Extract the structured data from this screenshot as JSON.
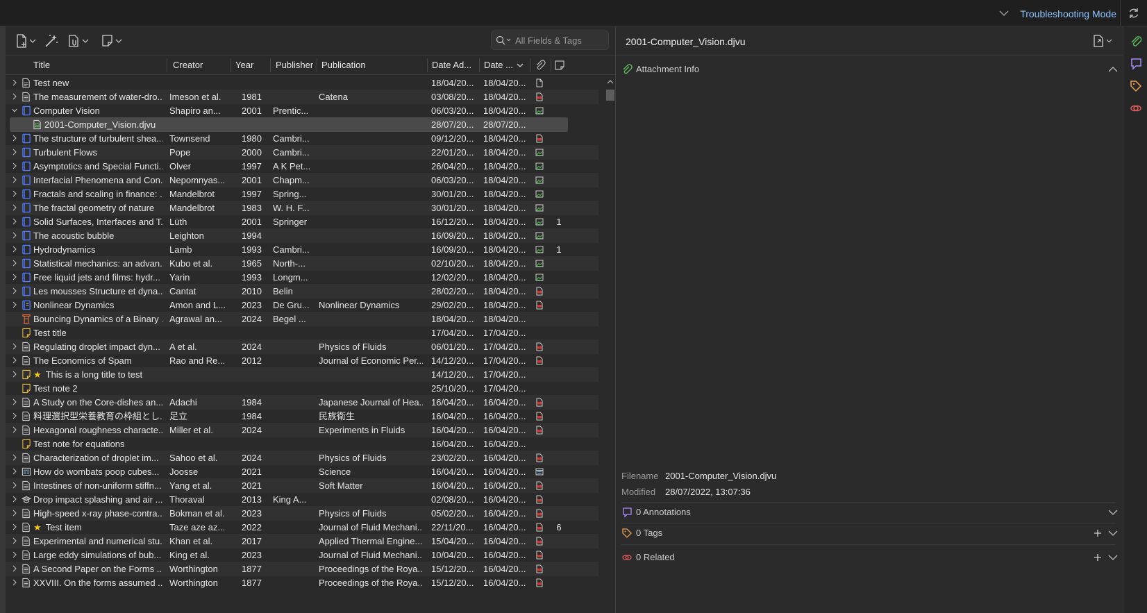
{
  "topbar": {
    "troubleshooting_label": "Troubleshooting Mode"
  },
  "search": {
    "placeholder": "All Fields & Tags"
  },
  "columns": {
    "title": "Title",
    "creator": "Creator",
    "year": "Year",
    "publisher": "Publisher",
    "publication": "Publication",
    "date_added": "Date Ad...",
    "date_modified": "Date ..."
  },
  "rows": [
    {
      "title": "Test new",
      "creator": "",
      "year": "",
      "publisher": "",
      "publication": "",
      "date_added": "18/04/20...",
      "date_modified": "18/04/20...",
      "type": "document",
      "att": "file",
      "notes": "",
      "twisty": "closed"
    },
    {
      "title": "The measurement of water-dro...",
      "creator": "Imeson et al.",
      "year": "1981",
      "publisher": "",
      "publication": "Catena",
      "date_added": "03/08/20...",
      "date_modified": "18/04/20...",
      "type": "article",
      "att": "pdf",
      "notes": "",
      "twisty": "closed"
    },
    {
      "title": "Computer Vision",
      "creator": "Shapiro an...",
      "year": "2001",
      "publisher": "Prentic...",
      "publication": "",
      "date_added": "06/03/20...",
      "date_modified": "18/04/20...",
      "type": "book",
      "att": "image",
      "notes": "",
      "twisty": "open"
    },
    {
      "title": "2001-Computer_Vision.djvu",
      "creator": "",
      "year": "",
      "publisher": "",
      "publication": "",
      "date_added": "28/07/20...",
      "date_modified": "28/07/20...",
      "type": "attachment",
      "att": "",
      "notes": "",
      "twisty": "none",
      "child": true,
      "selected": true
    },
    {
      "title": "The structure of turbulent shea...",
      "creator": "Townsend",
      "year": "1980",
      "publisher": "Cambri...",
      "publication": "",
      "date_added": "09/12/20...",
      "date_modified": "18/04/20...",
      "type": "book",
      "att": "pdf",
      "notes": "",
      "twisty": "closed"
    },
    {
      "title": "Turbulent Flows",
      "creator": "Pope",
      "year": "2000",
      "publisher": "Cambri...",
      "publication": "",
      "date_added": "22/01/20...",
      "date_modified": "18/04/20...",
      "type": "book",
      "att": "image",
      "notes": "",
      "twisty": "closed"
    },
    {
      "title": "Asymptotics and Special Functi...",
      "creator": "Olver",
      "year": "1997",
      "publisher": "A K Pet...",
      "publication": "",
      "date_added": "26/04/20...",
      "date_modified": "18/04/20...",
      "type": "book",
      "att": "image",
      "notes": "",
      "twisty": "closed"
    },
    {
      "title": "Interfacial Phenomena and Con...",
      "creator": "Nepomnyas...",
      "year": "2001",
      "publisher": "Chapm...",
      "publication": "",
      "date_added": "06/03/20...",
      "date_modified": "18/04/20...",
      "type": "book",
      "att": "image",
      "notes": "",
      "twisty": "closed"
    },
    {
      "title": "Fractals and scaling in finance: ...",
      "creator": "Mandelbrot",
      "year": "1997",
      "publisher": "Spring...",
      "publication": "",
      "date_added": "30/01/20...",
      "date_modified": "18/04/20...",
      "type": "book",
      "att": "image",
      "notes": "",
      "twisty": "closed"
    },
    {
      "title": "The fractal geometry of nature",
      "creator": "Mandelbrot",
      "year": "1983",
      "publisher": "W. H. F...",
      "publication": "",
      "date_added": "30/01/20...",
      "date_modified": "18/04/20...",
      "type": "book",
      "att": "image",
      "notes": "",
      "twisty": "closed"
    },
    {
      "title": "Solid Surfaces, Interfaces and T...",
      "creator": "Lüth",
      "year": "2001",
      "publisher": "Springer",
      "publication": "",
      "date_added": "16/12/20...",
      "date_modified": "18/04/20...",
      "type": "book",
      "att": "image",
      "notes": "1",
      "twisty": "closed"
    },
    {
      "title": "The acoustic bubble",
      "creator": "Leighton",
      "year": "1994",
      "publisher": "",
      "publication": "",
      "date_added": "16/09/20...",
      "date_modified": "18/04/20...",
      "type": "book",
      "att": "image",
      "notes": "",
      "twisty": "closed"
    },
    {
      "title": "Hydrodynamics",
      "creator": "Lamb",
      "year": "1993",
      "publisher": "Cambri...",
      "publication": "",
      "date_added": "16/09/20...",
      "date_modified": "18/04/20...",
      "type": "book",
      "att": "image",
      "notes": "1",
      "twisty": "closed"
    },
    {
      "title": "Statistical mechanics: an advan...",
      "creator": "Kubo et al.",
      "year": "1965",
      "publisher": "North-...",
      "publication": "",
      "date_added": "02/10/20...",
      "date_modified": "18/04/20...",
      "type": "book",
      "att": "image",
      "notes": "",
      "twisty": "closed"
    },
    {
      "title": "Free liquid jets and films: hydr...",
      "creator": "Yarin",
      "year": "1993",
      "publisher": "Longm...",
      "publication": "",
      "date_added": "12/02/20...",
      "date_modified": "18/04/20...",
      "type": "book",
      "att": "image",
      "notes": "",
      "twisty": "closed"
    },
    {
      "title": "Les mousses Structure et dyna...",
      "creator": "Cantat",
      "year": "2010",
      "publisher": "Belin",
      "publication": "",
      "date_added": "28/02/20...",
      "date_modified": "18/04/20...",
      "type": "book",
      "att": "pdf",
      "notes": "",
      "twisty": "closed"
    },
    {
      "title": "Nonlinear Dynamics",
      "creator": "Amon and L...",
      "year": "2023",
      "publisher": "De Gru...",
      "publication": "Nonlinear Dynamics",
      "date_added": "29/02/20...",
      "date_modified": "18/04/20...",
      "type": "book-section",
      "att": "pdf",
      "notes": "",
      "twisty": "closed"
    },
    {
      "title": "Bouncing Dynamics of a Binary ...",
      "creator": "Agrawal an...",
      "year": "2024",
      "publisher": "Begel ...",
      "publication": "",
      "date_added": "18/04/20...",
      "date_modified": "18/04/20...",
      "type": "conference",
      "att": "",
      "notes": "",
      "twisty": "none"
    },
    {
      "title": "Test title",
      "creator": "",
      "year": "",
      "publisher": "",
      "publication": "",
      "date_added": "17/04/20...",
      "date_modified": "17/04/20...",
      "type": "note",
      "att": "",
      "notes": "",
      "twisty": "none"
    },
    {
      "title": "Regulating droplet impact dyn...",
      "creator": "A et al.",
      "year": "2024",
      "publisher": "",
      "publication": "Physics of Fluids",
      "date_added": "06/01/20...",
      "date_modified": "17/04/20...",
      "type": "article",
      "att": "pdf",
      "notes": "",
      "twisty": "closed"
    },
    {
      "title": "The Economics of Spam",
      "creator": "Rao and Re...",
      "year": "2012",
      "publisher": "",
      "publication": "Journal of Economic Per...",
      "date_added": "14/12/20...",
      "date_modified": "17/04/20...",
      "type": "article",
      "att": "pdf",
      "notes": "",
      "twisty": "closed"
    },
    {
      "title": "This is a long title to test",
      "creator": "",
      "year": "",
      "publisher": "",
      "publication": "",
      "date_added": "14/12/20...",
      "date_modified": "17/04/20...",
      "type": "note",
      "att": "",
      "notes": "",
      "twisty": "closed",
      "star": true
    },
    {
      "title": "Test note 2",
      "creator": "",
      "year": "",
      "publisher": "",
      "publication": "",
      "date_added": "25/10/20...",
      "date_modified": "17/04/20...",
      "type": "note",
      "att": "",
      "notes": "",
      "twisty": "none"
    },
    {
      "title": "A Study on the Core-dishes an...",
      "creator": "Adachi",
      "year": "1984",
      "publisher": "",
      "publication": "Japanese Journal of Hea...",
      "date_added": "16/04/20...",
      "date_modified": "16/04/20...",
      "type": "article",
      "att": "pdf",
      "notes": "",
      "twisty": "closed"
    },
    {
      "title": "料理選択型栄養教育の枠組とし...",
      "creator": "足立",
      "year": "1984",
      "publisher": "",
      "publication": "民族衛生",
      "date_added": "16/04/20...",
      "date_modified": "16/04/20...",
      "type": "article",
      "att": "pdf",
      "notes": "",
      "twisty": "closed"
    },
    {
      "title": "Hexagonal roughness characte...",
      "creator": "Miller et al.",
      "year": "2024",
      "publisher": "",
      "publication": "Experiments in Fluids",
      "date_added": "16/04/20...",
      "date_modified": "16/04/20...",
      "type": "article",
      "att": "pdf",
      "notes": "",
      "twisty": "closed"
    },
    {
      "title": "Test note for equations",
      "creator": "",
      "year": "",
      "publisher": "",
      "publication": "",
      "date_added": "16/04/20...",
      "date_modified": "16/04/20...",
      "type": "note",
      "att": "",
      "notes": "",
      "twisty": "none"
    },
    {
      "title": "Characterization of droplet im...",
      "creator": "Sahoo et al.",
      "year": "2024",
      "publisher": "",
      "publication": "Physics of Fluids",
      "date_added": "23/02/20...",
      "date_modified": "16/04/20...",
      "type": "article",
      "att": "pdf",
      "notes": "",
      "twisty": "closed"
    },
    {
      "title": "How do wombats poop cubes...",
      "creator": "Joosse",
      "year": "2021",
      "publisher": "",
      "publication": "Science",
      "date_added": "16/04/20...",
      "date_modified": "16/04/20...",
      "type": "magazine",
      "att": "snapshot",
      "notes": "",
      "twisty": "closed"
    },
    {
      "title": "Intestines of non-uniform stiffn...",
      "creator": "Yang et al.",
      "year": "2021",
      "publisher": "",
      "publication": "Soft Matter",
      "date_added": "16/04/20...",
      "date_modified": "16/04/20...",
      "type": "article",
      "att": "pdf",
      "notes": "",
      "twisty": "closed"
    },
    {
      "title": "Drop impact splashing and air ...",
      "creator": "Thoraval",
      "year": "2013",
      "publisher": "King A...",
      "publication": "",
      "date_added": "02/08/20...",
      "date_modified": "16/04/20...",
      "type": "thesis",
      "att": "pdf",
      "notes": "",
      "twisty": "closed"
    },
    {
      "title": "High-speed x-ray phase-contra...",
      "creator": "Bokman et al.",
      "year": "2023",
      "publisher": "",
      "publication": "Physics of Fluids",
      "date_added": "05/02/20...",
      "date_modified": "16/04/20...",
      "type": "article",
      "att": "pdf",
      "notes": "",
      "twisty": "closed"
    },
    {
      "title": "Test item",
      "creator": "Taze aze az...",
      "year": "2022",
      "publisher": "",
      "publication": "Journal of Fluid Mechani...",
      "date_added": "22/11/20...",
      "date_modified": "16/04/20...",
      "type": "article",
      "att": "pdf",
      "notes": "6",
      "twisty": "closed",
      "star": true
    },
    {
      "title": "Experimental and numerical stu...",
      "creator": "Khan et al.",
      "year": "2017",
      "publisher": "",
      "publication": "Applied Thermal Engine...",
      "date_added": "15/04/20...",
      "date_modified": "16/04/20...",
      "type": "article",
      "att": "pdf",
      "notes": "",
      "twisty": "closed"
    },
    {
      "title": "Large eddy simulations of bub...",
      "creator": "King et al.",
      "year": "2023",
      "publisher": "",
      "publication": "Journal of Fluid Mechani...",
      "date_added": "10/04/20...",
      "date_modified": "16/04/20...",
      "type": "article",
      "att": "pdf",
      "notes": "",
      "twisty": "closed"
    },
    {
      "title": "A Second Paper on the Forms ...",
      "creator": "Worthington",
      "year": "1877",
      "publisher": "",
      "publication": "Proceedings of the Roya...",
      "date_added": "15/12/20...",
      "date_modified": "16/04/20...",
      "type": "article",
      "att": "pdf",
      "notes": "",
      "twisty": "closed"
    },
    {
      "title": "XXVIII. On the forms assumed ...",
      "creator": "Worthington",
      "year": "1877",
      "publisher": "",
      "publication": "Proceedings of the Roya...",
      "date_added": "15/12/20...",
      "date_modified": "16/04/20...",
      "type": "article",
      "att": "pdf",
      "notes": "",
      "twisty": "closed"
    }
  ],
  "item_pane": {
    "filename_header": "2001-Computer_Vision.djvu",
    "attachment_info_title": "Attachment Info",
    "filename_label": "Filename",
    "filename_value": "2001-Computer_Vision.djvu",
    "modified_label": "Modified",
    "modified_value": "28/07/2022, 13:07:36",
    "annotations_title": "0 Annotations",
    "tags_title": "0 Tags",
    "related_title": "0 Related"
  },
  "icons": {
    "new-item": "new-item-icon",
    "magic-wand": "magic-wand-icon",
    "add-attachment": "add-attachment-icon",
    "new-note": "new-note-icon",
    "search": "search-icon",
    "attachment-column": "paperclip-icon",
    "notes-column": "note-icon",
    "refresh": "refresh-icon",
    "info": "attachment-info-icon",
    "annotations": "annotations-icon",
    "tags": "tag-icon",
    "related": "related-icon"
  },
  "colors": {
    "accent_link": "#8ec5ff",
    "icon_green": "#5cb85c",
    "icon_purple": "#a98cff",
    "icon_orange": "#f0a050",
    "icon_red": "#e05a5a",
    "pdf_red": "#d8342e",
    "book_blue": "#4d7cff",
    "star": "#f5c518"
  }
}
